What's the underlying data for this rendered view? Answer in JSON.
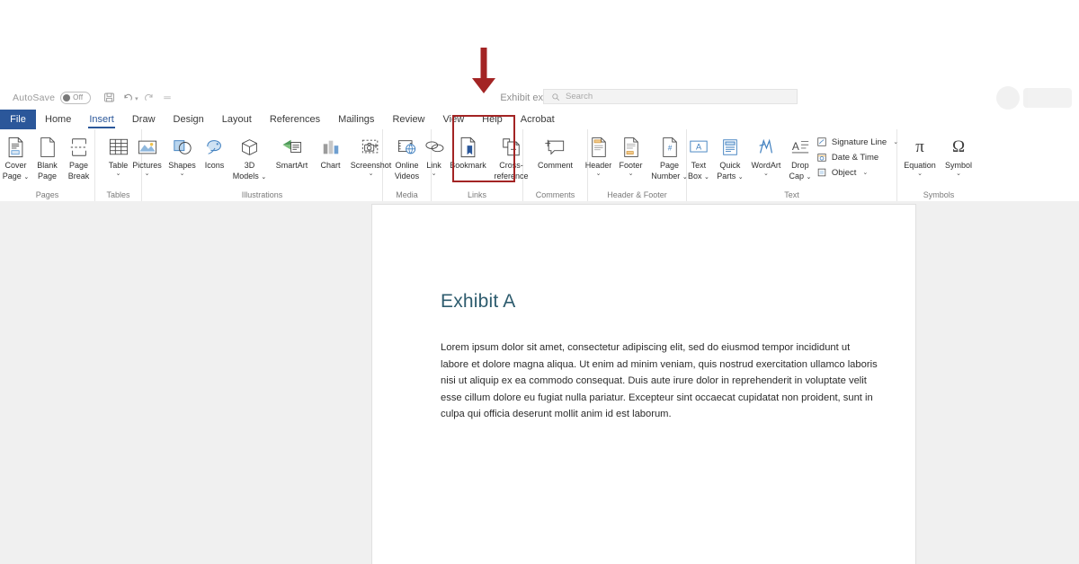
{
  "app": {
    "name": "Microsoft Word",
    "accent_color": "#2b579a",
    "annotation_color": "#a32424"
  },
  "titlebar": {
    "autosave_label": "AutoSave",
    "autosave_state": "Off",
    "quick_access": [
      {
        "name": "save-icon",
        "tooltip": "Save"
      },
      {
        "name": "undo-icon",
        "tooltip": "Undo"
      },
      {
        "name": "redo-icon",
        "tooltip": "Redo"
      },
      {
        "name": "customize-quick-access-icon",
        "tooltip": "Customize Quick Access Toolbar"
      }
    ],
    "document_title": "Exhibit example",
    "title_caret": "⌄"
  },
  "search": {
    "placeholder": "Search",
    "icon": "search-icon"
  },
  "tabs": [
    {
      "label": "File",
      "active": false,
      "is_file": true
    },
    {
      "label": "Home",
      "active": false
    },
    {
      "label": "Insert",
      "active": true
    },
    {
      "label": "Draw",
      "active": false
    },
    {
      "label": "Design",
      "active": false
    },
    {
      "label": "Layout",
      "active": false
    },
    {
      "label": "References",
      "active": false
    },
    {
      "label": "Mailings",
      "active": false
    },
    {
      "label": "Review",
      "active": false
    },
    {
      "label": "View",
      "active": false
    },
    {
      "label": "Help",
      "active": false
    },
    {
      "label": "Acrobat",
      "active": false
    }
  ],
  "ribbon": {
    "groups": [
      {
        "label": "Pages",
        "items": [
          {
            "label": "Cover\nPage",
            "label_line1": "Cover",
            "label_line2": "Page",
            "dropdown": true,
            "icon": "cover-page-icon",
            "inline_caret": true
          },
          {
            "label_line1": "Blank",
            "label_line2": "Page",
            "dropdown": false,
            "icon": "blank-page-icon"
          },
          {
            "label_line1": "Page",
            "label_line2": "Break",
            "dropdown": false,
            "icon": "page-break-icon"
          }
        ]
      },
      {
        "label": "Tables",
        "items": [
          {
            "label_line1": "Table",
            "label_line2": "",
            "dropdown": true,
            "icon": "table-icon"
          }
        ]
      },
      {
        "label": "Illustrations",
        "items": [
          {
            "label_line1": "Pictures",
            "label_line2": "",
            "dropdown": true,
            "icon": "pictures-icon"
          },
          {
            "label_line1": "Shapes",
            "label_line2": "",
            "dropdown": true,
            "icon": "shapes-icon"
          },
          {
            "label_line1": "Icons",
            "label_line2": "",
            "dropdown": false,
            "icon": "icons-icon"
          },
          {
            "label_line1": "3D",
            "label_line2": "Models",
            "dropdown": true,
            "icon": "3d-models-icon",
            "inline_caret": true
          },
          {
            "label_line1": "SmartArt",
            "label_line2": "",
            "dropdown": false,
            "icon": "smartart-icon"
          },
          {
            "label_line1": "Chart",
            "label_line2": "",
            "dropdown": false,
            "icon": "chart-icon"
          },
          {
            "label_line1": "Screenshot",
            "label_line2": "",
            "dropdown": true,
            "icon": "screenshot-icon"
          }
        ]
      },
      {
        "label": "Media",
        "items": [
          {
            "label_line1": "Online",
            "label_line2": "Videos",
            "dropdown": false,
            "icon": "online-videos-icon"
          }
        ]
      },
      {
        "label": "Links",
        "highlighted": true,
        "items": [
          {
            "label_line1": "Link",
            "label_line2": "",
            "dropdown": true,
            "icon": "link-icon"
          },
          {
            "label_line1": "Bookmark",
            "label_line2": "",
            "dropdown": false,
            "icon": "bookmark-icon"
          },
          {
            "label_line1": "Cross-",
            "label_line2": "reference",
            "dropdown": false,
            "icon": "cross-reference-icon"
          }
        ]
      },
      {
        "label": "Comments",
        "items": [
          {
            "label_line1": "Comment",
            "label_line2": "",
            "dropdown": false,
            "icon": "comment-icon"
          }
        ]
      },
      {
        "label": "Header & Footer",
        "items": [
          {
            "label_line1": "Header",
            "label_line2": "",
            "dropdown": true,
            "icon": "header-icon"
          },
          {
            "label_line1": "Footer",
            "label_line2": "",
            "dropdown": true,
            "icon": "footer-icon"
          },
          {
            "label_line1": "Page",
            "label_line2": "Number",
            "dropdown": true,
            "icon": "page-number-icon",
            "inline_caret": true
          }
        ]
      },
      {
        "label": "Text",
        "items": [
          {
            "label_line1": "Text",
            "label_line2": "Box",
            "dropdown": true,
            "icon": "text-box-icon",
            "inline_caret": true
          },
          {
            "label_line1": "Quick",
            "label_line2": "Parts",
            "dropdown": true,
            "icon": "quick-parts-icon",
            "inline_caret": true
          },
          {
            "label_line1": "WordArt",
            "label_line2": "",
            "dropdown": true,
            "icon": "wordart-icon"
          },
          {
            "label_line1": "Drop",
            "label_line2": "Cap",
            "dropdown": true,
            "icon": "drop-cap-icon",
            "inline_caret": true
          }
        ],
        "small_items": [
          {
            "label": "Signature Line",
            "icon": "signature-line-icon",
            "caret": "⌄"
          },
          {
            "label": "Date & Time",
            "icon": "date-time-icon",
            "caret": ""
          },
          {
            "label": "Object",
            "icon": "object-icon",
            "caret": "⌄"
          }
        ]
      },
      {
        "label": "Symbols",
        "items": [
          {
            "label_line1": "Equation",
            "label_line2": "",
            "dropdown": true,
            "icon": "equation-icon",
            "glyph": "π"
          },
          {
            "label_line1": "Symbol",
            "label_line2": "",
            "dropdown": true,
            "icon": "symbol-icon",
            "glyph": "Ω"
          }
        ]
      }
    ]
  },
  "annotation": {
    "arrow": "down-arrow-annotation",
    "box_target": "links-group",
    "color": "#a32424"
  },
  "document": {
    "heading": "Exhibit A",
    "body": "Lorem ipsum dolor sit amet, consectetur adipiscing elit, sed do eiusmod tempor incididunt ut labore et dolore magna aliqua. Ut enim ad minim veniam, quis nostrud exercitation ullamco laboris nisi ut aliquip ex ea commodo consequat. Duis aute irure dolor in reprehenderit in voluptate velit esse cillum dolore eu fugiat nulla pariatur. Excepteur sint occaecat cupidatat non proident, sunt in culpa qui officia deserunt mollit anim id est laborum.",
    "heading_color": "#2e5c6e"
  }
}
